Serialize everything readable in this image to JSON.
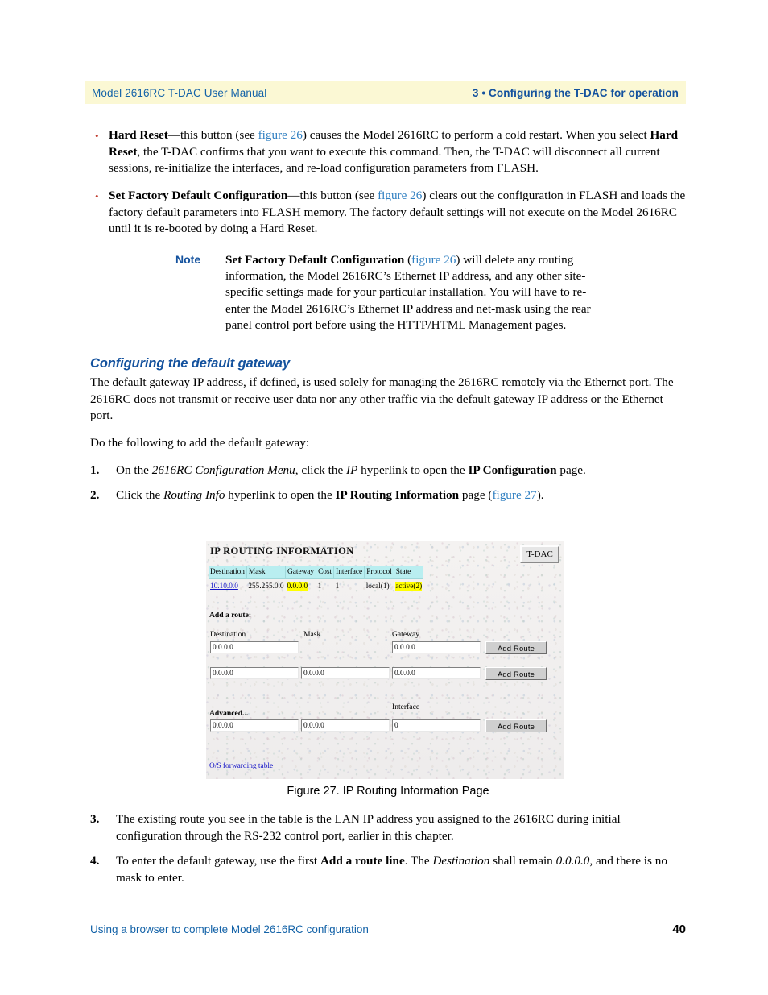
{
  "header": {
    "left": "Model 2616RC T-DAC User Manual",
    "right": "3 • Configuring the T-DAC for operation"
  },
  "bullets": [
    {
      "term": "Hard Reset",
      "text_1": "—this button (see ",
      "xref": "figure 26",
      "text_2": ") causes the Model 2616RC to perform a cold restart. When you select ",
      "term_2": "Hard Reset",
      "text_3": ", the T-DAC confirms that you want to execute this command. Then, the T-DAC will disconnect all current sessions, re-initialize the interfaces, and re-load configuration parameters from FLASH."
    },
    {
      "term": "Set Factory Default Configuration",
      "text_1": "—this button (see ",
      "xref": "figure 26",
      "text_2": ") clears out the configuration in FLASH and loads the factory default parameters into FLASH memory. The factory default settings will not execute on the Model 2616RC until it is re-booted by doing a Hard Reset.",
      "term_2": "",
      "text_3": ""
    }
  ],
  "note": {
    "label": "Note",
    "term": "Set Factory Default Configuration",
    "text_1": " (",
    "xref": "figure 26",
    "text_2": ") will delete any routing information, the Model 2616RC’s Ethernet IP address, and any other site-specific settings made for your particular installation. You will have to re-enter the Model 2616RC’s Ethernet IP address and net-mask using the rear panel control port before using the HTTP/HTML Management pages."
  },
  "section": {
    "heading": "Configuring the default gateway",
    "para_1": "The default gateway IP address, if defined, is used solely for managing the 2616RC remotely via the Ethernet port. The 2616RC does not transmit or receive user data nor any other traffic via the default gateway IP address or the Ethernet port.",
    "para_2": "Do the following to add the default gateway:"
  },
  "steps_upper": [
    {
      "num": "1.",
      "t1": "On the ",
      "em1": "2616RC Configuration Menu",
      "t2": ", click the ",
      "em2": "IP",
      "t3": " hyperlink to open the ",
      "b1": "IP Configuration",
      "t4": " page.",
      "xref": "",
      "t5": ""
    },
    {
      "num": "2.",
      "t1": "Click the ",
      "em1": "Routing Info",
      "t2": " hyperlink to open the ",
      "em2": "",
      "t3": "",
      "b1": "IP Routing Information",
      "t4": " page (",
      "xref": "figure 27",
      "t5": ")."
    }
  ],
  "figure": {
    "caption": "Figure 27. IP Routing Information Page",
    "screenshot": {
      "title": "IP ROUTING INFORMATION",
      "logo_button": "T-DAC",
      "table": {
        "columns": [
          "Destination",
          "Mask",
          "Gateway",
          "Cost",
          "Interface",
          "Protocol",
          "State"
        ],
        "rows": [
          {
            "destination": "10.10.0.0",
            "mask": "255.255.0.0",
            "gateway": "0.0.0.0",
            "cost": "1",
            "interface": "1",
            "protocol": "local(1)",
            "state": "active(2)"
          }
        ]
      },
      "add_route_label": "Add a route:",
      "col_labels": {
        "destination": "Destination",
        "mask": "Mask",
        "gateway": "Gateway",
        "interface": "Interface"
      },
      "advanced_label": "Advanced...",
      "form_rows": [
        {
          "destination": "0.0.0.0",
          "mask": "",
          "gateway": "0.0.0.0",
          "button": "Add Route"
        },
        {
          "destination": "0.0.0.0",
          "mask": "0.0.0.0",
          "gateway": "0.0.0.0",
          "button": "Add Route"
        },
        {
          "destination": "0.0.0.0",
          "mask": "0.0.0.0",
          "gateway": "0",
          "button": "Add Route"
        }
      ],
      "os_link": "O/S forwarding table"
    }
  },
  "steps_lower": [
    {
      "num": "3.",
      "t1": "The existing route you see in the table is the LAN IP address you assigned to the 2616RC during initial configuration through the RS-232 control port, earlier in this chapter.",
      "b1": "",
      "t2": "",
      "em1": "",
      "t3": "",
      "em2": "",
      "t4": ""
    },
    {
      "num": "4.",
      "t1": "To enter the default gateway, use the first ",
      "b1": "Add a route line",
      "t2": ". The ",
      "em1": "Destination",
      "t3": " shall remain ",
      "em2": "0.0.0.0",
      "t4": ", and there is no mask to enter."
    }
  ],
  "footer": {
    "left": "Using a browser to complete Model 2616RC configuration",
    "page": "40"
  },
  "colors": {
    "header_band": "#fbf8d4",
    "accent_blue": "#14529e",
    "link_blue": "#2f7fc1",
    "table_header_cyan": "#b9eef0",
    "highlight_yellow": "#ffff00"
  }
}
